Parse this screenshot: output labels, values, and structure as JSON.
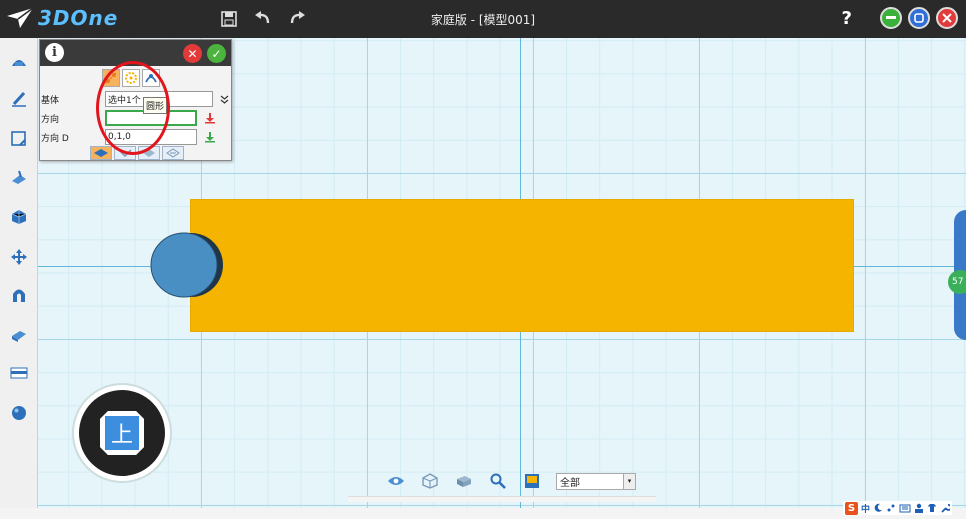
{
  "app": {
    "logo_text": "3DOne",
    "window_title": "家庭版 - [模型001]",
    "help_label": "?"
  },
  "toolbar": {
    "icons": [
      "save-icon",
      "undo-icon",
      "redo-icon"
    ]
  },
  "window_controls": {
    "minimize_color": "#3bb03b",
    "maximize_color": "#2f6fd6",
    "close_color": "#e23a3a"
  },
  "left_toolbar": {
    "items": [
      "basic-shapes-icon",
      "sketch-icon",
      "sketch-edit-icon",
      "feature-icon",
      "special-feature-icon",
      "move-icon",
      "combine-icon",
      "measure-icon",
      "view-icon",
      "material-icon"
    ]
  },
  "dialog": {
    "info_label": "i",
    "close_label": "✕",
    "ok_label": "✓",
    "fields": [
      {
        "label": "基体",
        "value": "选中1个"
      },
      {
        "label": "方向",
        "value": ""
      },
      {
        "label": "方向 D",
        "value": "0,1,0"
      }
    ],
    "tooltip": "圆形"
  },
  "viewport": {
    "model_color": "#f5b400",
    "cylinder_color": "#4a8fc4",
    "side_circle_label": "57"
  },
  "nav_cube": {
    "face_label": "上"
  },
  "bottom_bar": {
    "filter_value": "全部"
  },
  "ime": {
    "logo": "S",
    "text": "中"
  }
}
